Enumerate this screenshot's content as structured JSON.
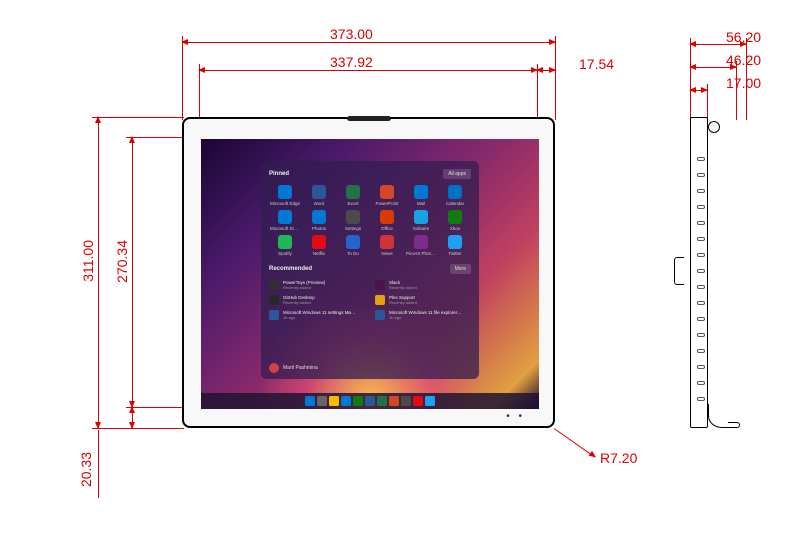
{
  "dimensions": {
    "front_width": "373.00",
    "screen_width": "337.92",
    "right_bezel": "17.54",
    "front_height": "311.00",
    "screen_height": "270.34",
    "bottom_bezel": "20.33",
    "corner_radius": "R7.20",
    "side_depth_outer": "56.20",
    "side_depth_mid": "46.20",
    "side_depth_inner": "17.00"
  },
  "colors": {
    "dim": "#d00",
    "edge": "#0078d4",
    "word": "#2b579a",
    "excel": "#217346",
    "ppt": "#d24726",
    "mail": "#0078d4",
    "calendar": "#0072c6",
    "store": "#0078d4",
    "photos": "#0078d4",
    "settings": "#4a4a4a",
    "office": "#d83b01",
    "solitaire": "#1ba1e2",
    "xbox": "#107c10",
    "spotify": "#1db954",
    "netflix": "#e50914",
    "todo": "#2564cf",
    "news": "#d13438",
    "pp_studio": "#7b2d8e",
    "twitter": "#1da1f2"
  },
  "start_menu": {
    "pinned_label": "Pinned",
    "all_apps_label": "All apps",
    "rec_label": "Recommended",
    "more_label": "More",
    "user": "Marti Pashmina",
    "icons": [
      {
        "label": "Microsoft Edge",
        "color": "#0078d4"
      },
      {
        "label": "Word",
        "color": "#2b579a"
      },
      {
        "label": "Excel",
        "color": "#217346"
      },
      {
        "label": "PowerPoint",
        "color": "#d24726"
      },
      {
        "label": "Mail",
        "color": "#0078d4"
      },
      {
        "label": "Calendar",
        "color": "#0072c6"
      },
      {
        "label": "Microsoft Store",
        "color": "#0078d4"
      },
      {
        "label": "Photos",
        "color": "#0078d4"
      },
      {
        "label": "Settings",
        "color": "#4a4a4a"
      },
      {
        "label": "Office",
        "color": "#d83b01"
      },
      {
        "label": "Solitaire",
        "color": "#1ba1e2"
      },
      {
        "label": "Xbox",
        "color": "#107c10"
      },
      {
        "label": "Spotify",
        "color": "#1db954"
      },
      {
        "label": "Netflix",
        "color": "#e50914"
      },
      {
        "label": "To Do",
        "color": "#2564cf"
      },
      {
        "label": "News",
        "color": "#d13438"
      },
      {
        "label": "PicsArt Photo Studio: Collage…",
        "color": "#7b2d8e"
      },
      {
        "label": "Twitter",
        "color": "#1da1f2"
      }
    ],
    "recommended": [
      {
        "title": "PowerToys (Preview)",
        "sub": "Recently added",
        "color": "#303030"
      },
      {
        "title": "Slack",
        "sub": "Recently added",
        "color": "#4a154b"
      },
      {
        "title": "GitHub Desktop",
        "sub": "Recently added",
        "color": "#24292e"
      },
      {
        "title": "Plex Support",
        "sub": "Recently added",
        "color": "#e5a00d"
      },
      {
        "title": "Microsoft Windows 11 settings Ma…",
        "sub": "1h ago",
        "color": "#2b579a"
      },
      {
        "title": "Microsoft Windows 11 file explorer…",
        "sub": "1h ago",
        "color": "#2b579a"
      }
    ]
  },
  "taskbar": {
    "icons_count": 11
  }
}
